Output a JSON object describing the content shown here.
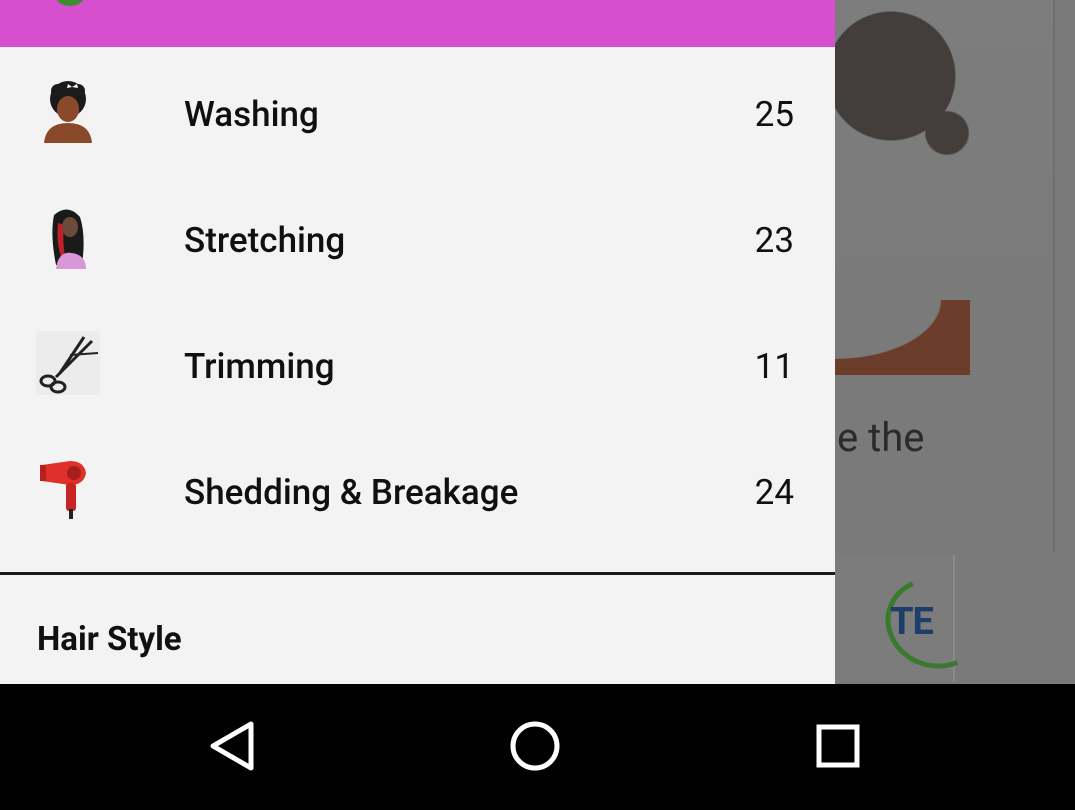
{
  "background": {
    "text_fragment": "e the",
    "ad_logo_text": "TE"
  },
  "drawer": {
    "active_item_icon": "leaf-icon",
    "items": [
      {
        "label": "Washing",
        "count": "25",
        "icon": "afro-woman-icon"
      },
      {
        "label": "Stretching",
        "count": "23",
        "icon": "long-hair-woman-icon"
      },
      {
        "label": "Trimming",
        "count": "11",
        "icon": "scissors-icon"
      },
      {
        "label": "Shedding & Breakage",
        "count": "24",
        "icon": "hair-dryer-icon"
      }
    ],
    "section_title": "Hair Style"
  },
  "navbar": {
    "back_icon": "back-triangle-icon",
    "home_icon": "home-circle-icon",
    "recents_icon": "recents-square-icon"
  },
  "colors": {
    "active_item": "#d54fcf",
    "drawer_bg": "#f3f3f3",
    "scrim": "#7a7a7a"
  }
}
